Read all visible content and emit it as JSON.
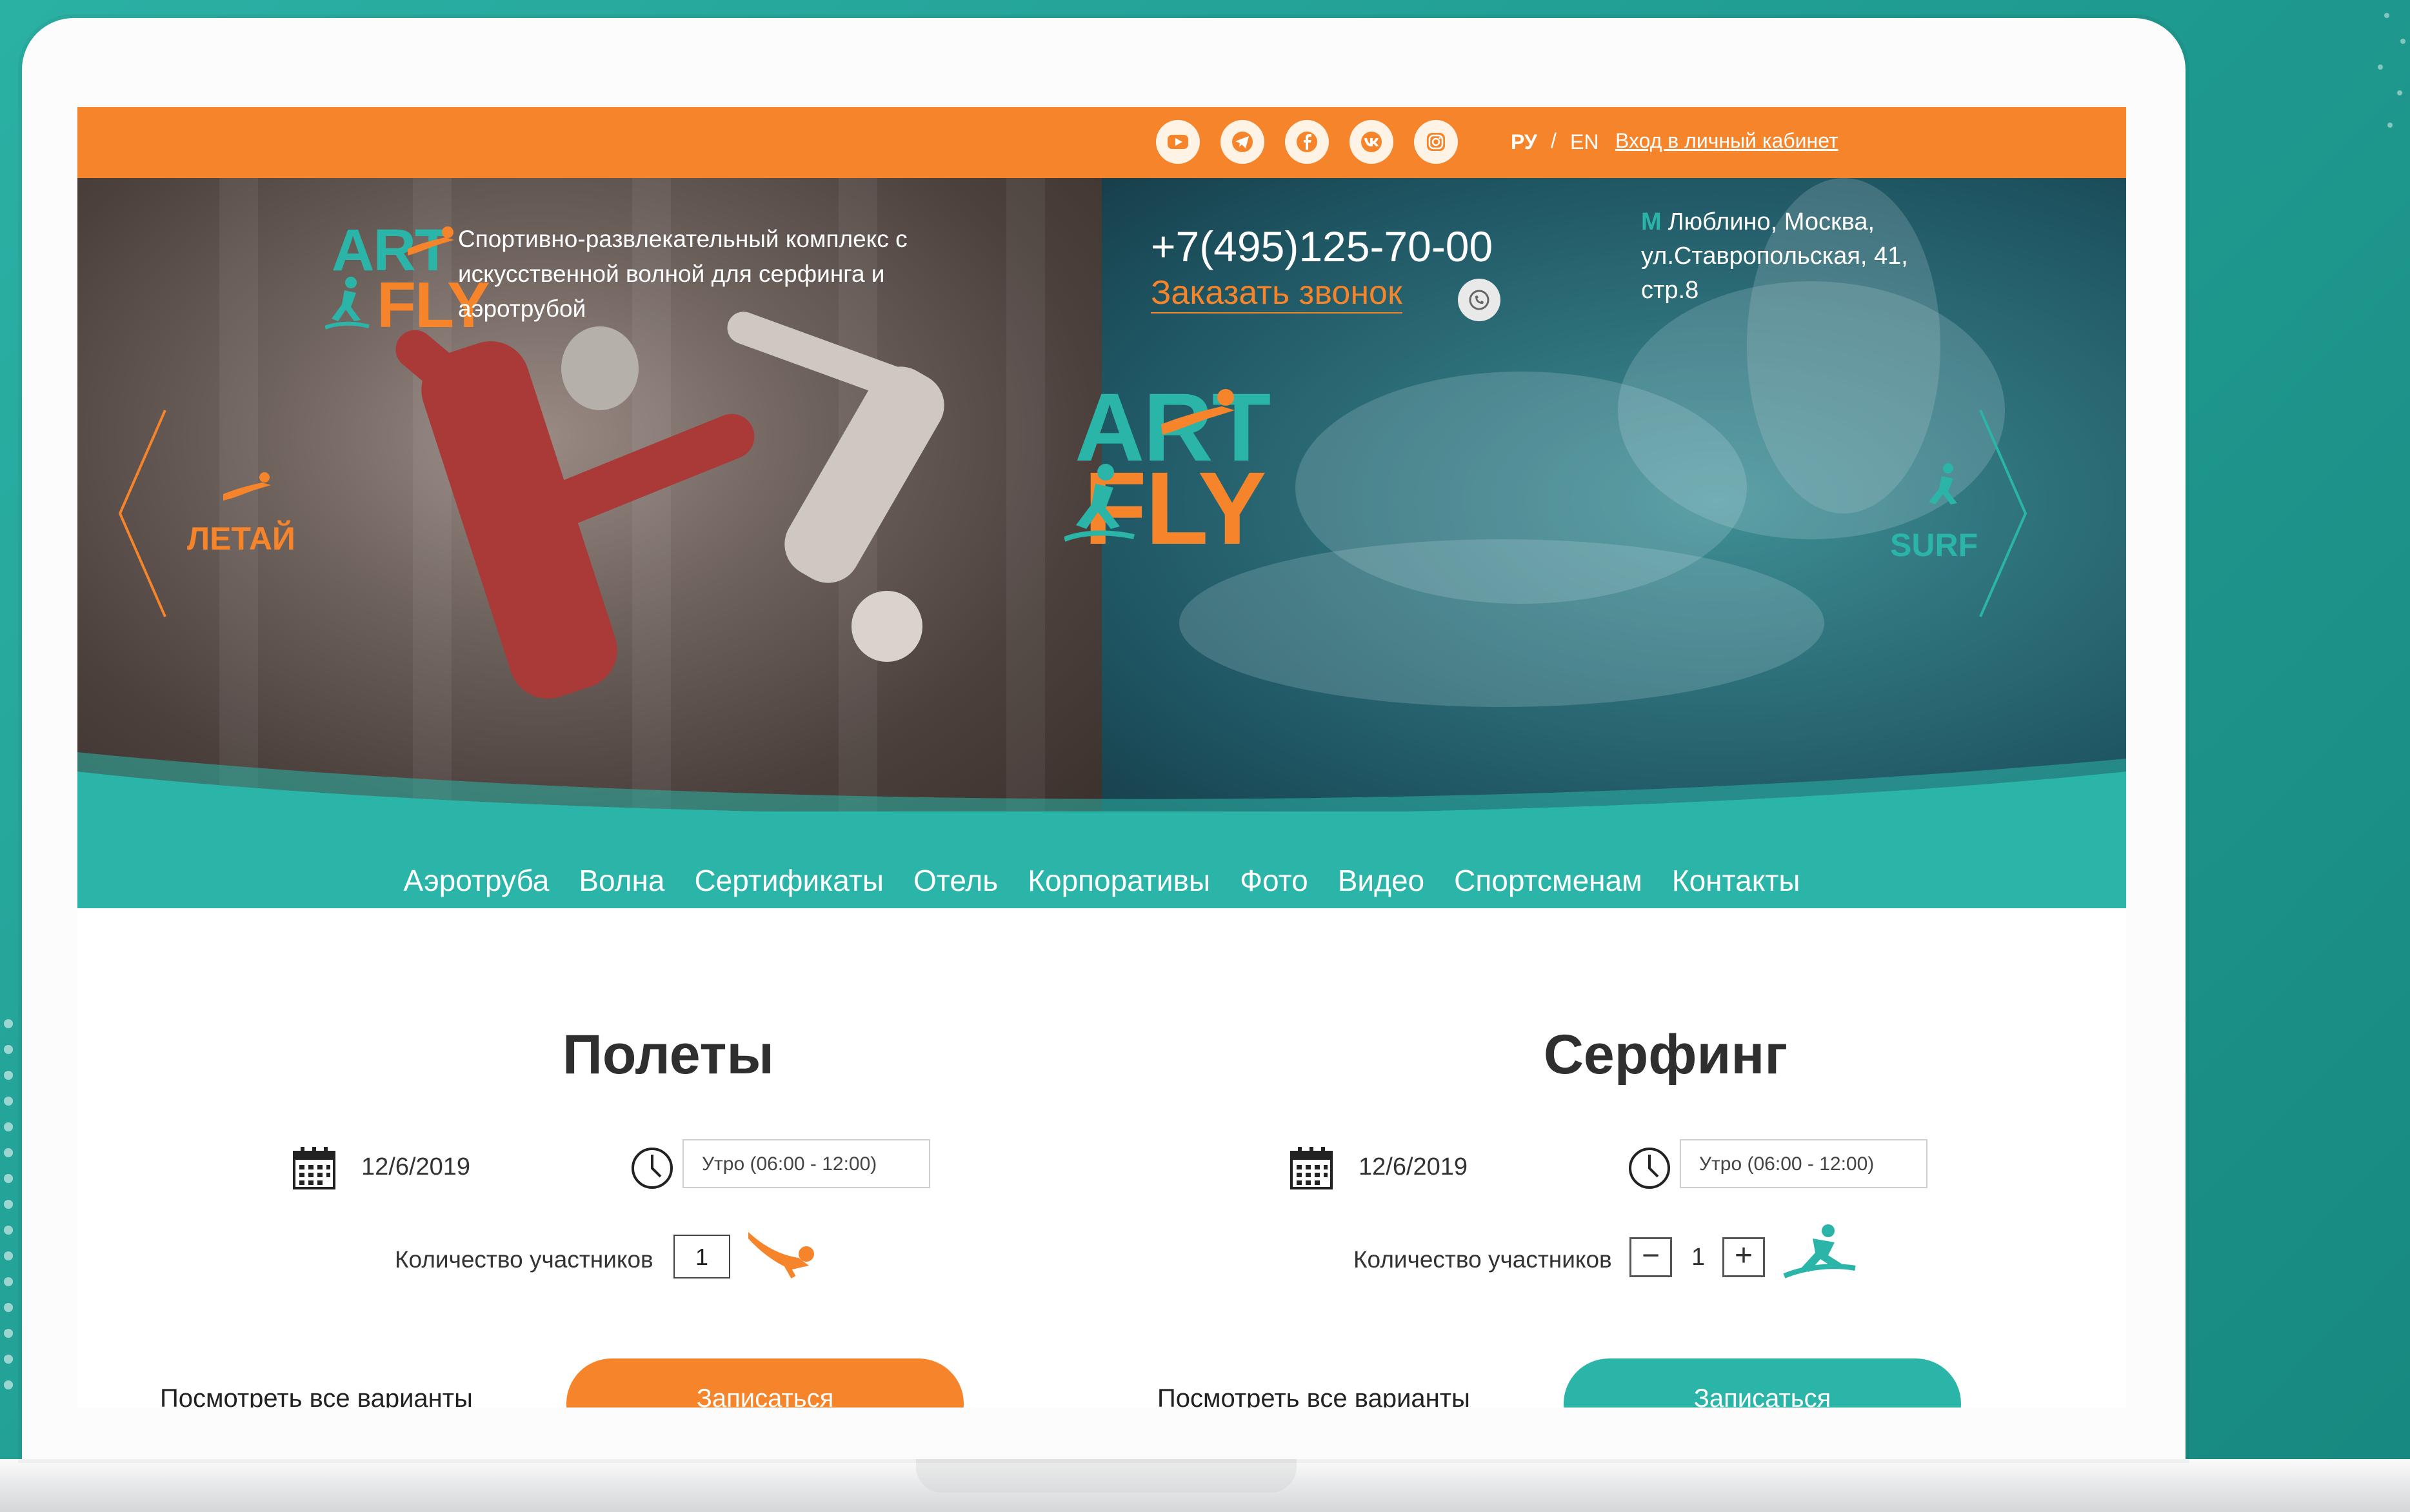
{
  "topbar": {
    "socials": [
      {
        "icon": "youtube-icon"
      },
      {
        "icon": "telegram-icon"
      },
      {
        "icon": "facebook-icon"
      },
      {
        "icon": "vk-icon"
      },
      {
        "icon": "instagram-icon"
      }
    ],
    "lang_ru": "РУ",
    "lang_sep": "/",
    "lang_en": "EN",
    "login": "Вход в личный кабинет"
  },
  "hero": {
    "logo_art": "ART",
    "logo_fly": "FLY",
    "tagline": "Спортивно-развлекательный комплекс с искусственной волной для серфинга и аэротрубой",
    "phone": "+7(495)125-70-00",
    "callback": "Заказать звонок",
    "metro_icon": "M",
    "address": "Люблино, Москва, ул.Ставропольская, 41, стр.8",
    "fly_label": "ЛЕТАЙ",
    "surf_label": "SURF"
  },
  "nav": {
    "items": [
      "Аэротруба",
      "Волна",
      "Сертификаты",
      "Отель",
      "Корпоративы",
      "Фото",
      "Видео",
      "Спортсменам",
      "Контакты"
    ]
  },
  "booking": {
    "flights": {
      "title": "Полеты",
      "date": "12/6/2019",
      "time": "Утро (06:00 - 12:00)",
      "qty_label": "Количество участников",
      "qty": "1",
      "view_all": "Посмотреть все варианты",
      "button": "Записаться"
    },
    "surfing": {
      "title": "Серфинг",
      "date": "12/6/2019",
      "time": "Утро (06:00 - 12:00)",
      "qty_label": "Количество участников",
      "minus": "−",
      "qty": "1",
      "plus": "+",
      "view_all": "Посмотреть все варианты",
      "button": "Записаться"
    }
  },
  "colors": {
    "orange": "#f6842a",
    "teal": "#2bb5a8"
  }
}
